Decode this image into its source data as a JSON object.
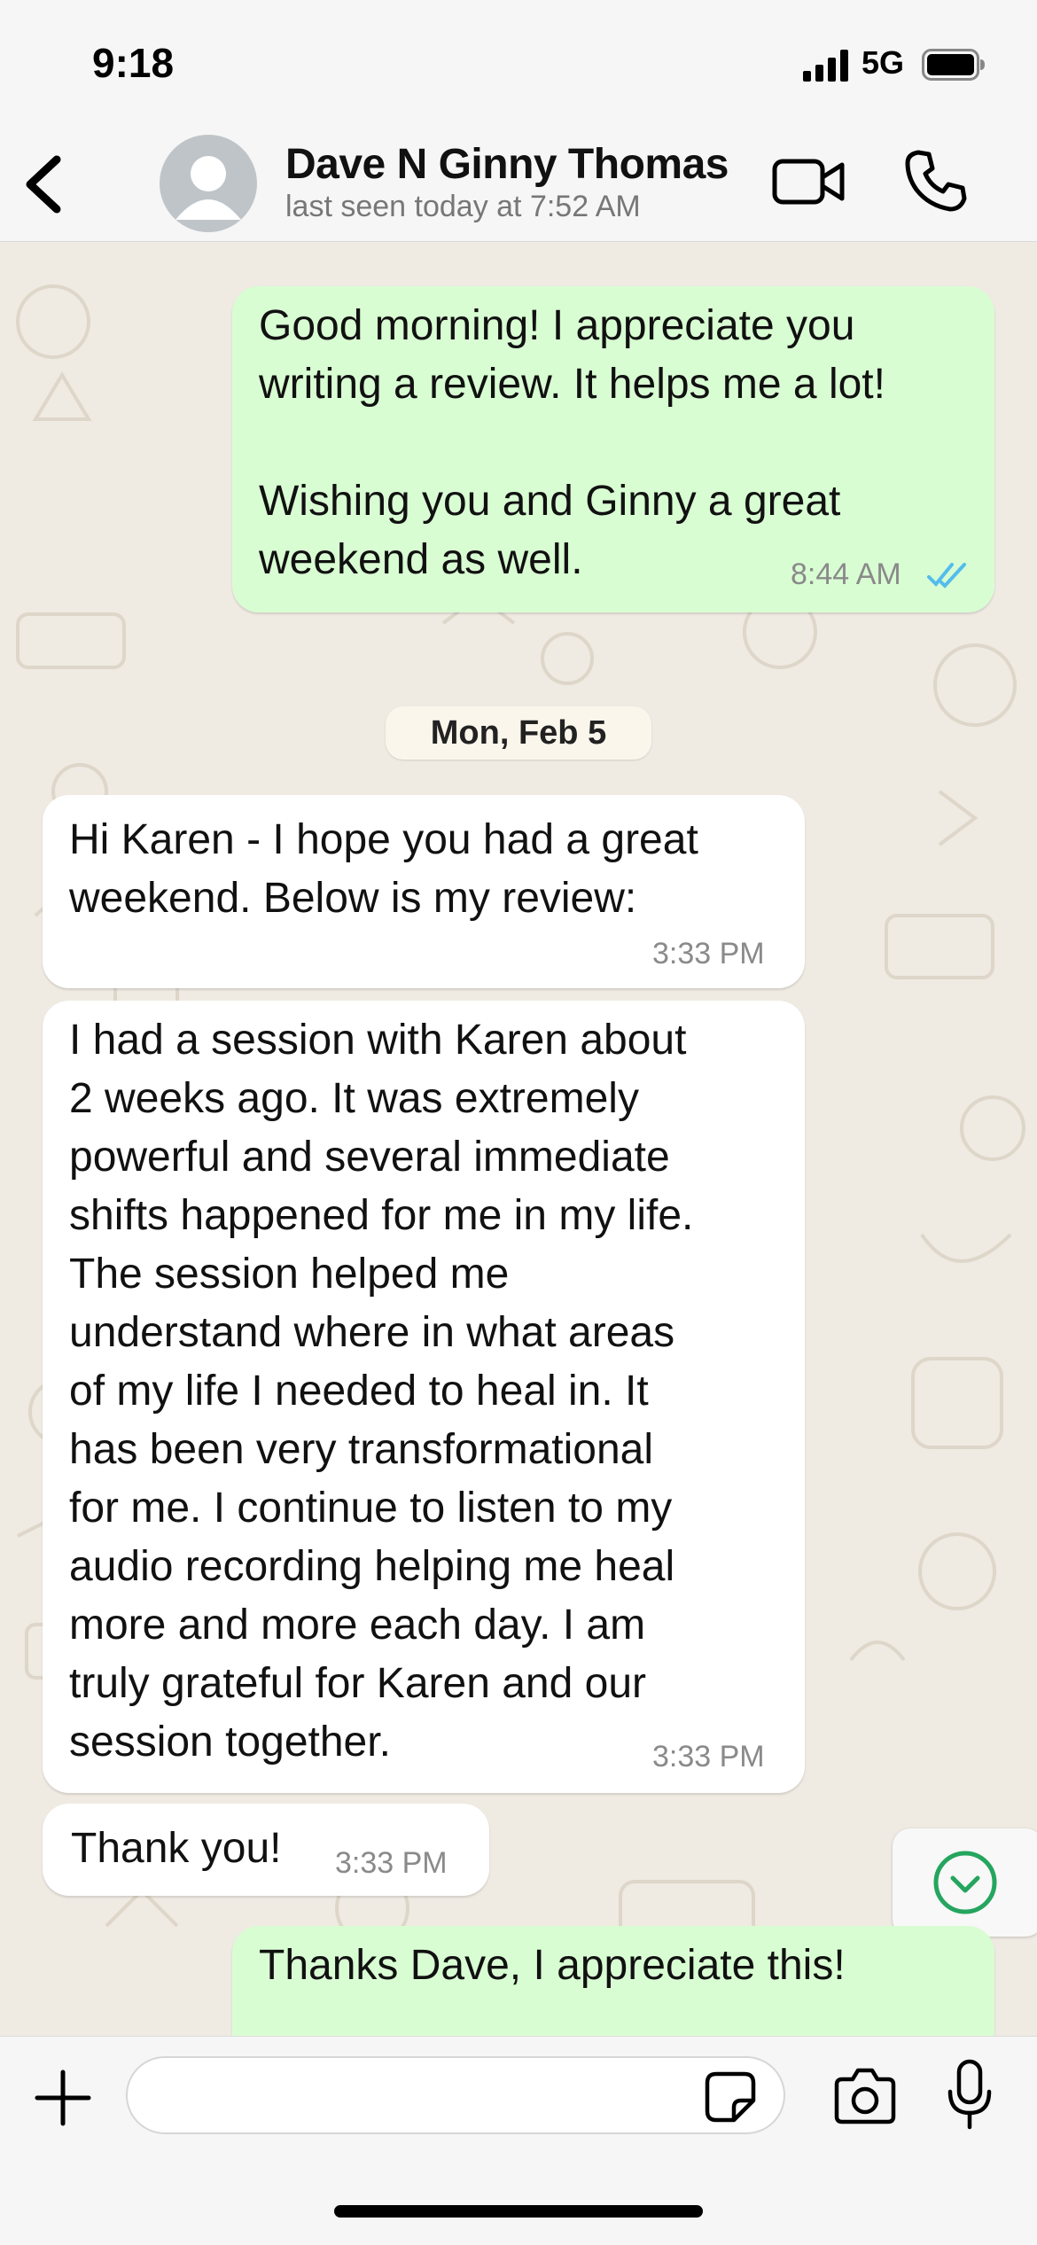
{
  "status_bar": {
    "time": "9:18",
    "network": "5G",
    "signal_icon": "signal-bars-icon",
    "battery_icon": "battery-icon"
  },
  "header": {
    "contact_name": "Dave N Ginny Thomas",
    "last_seen": "last seen today at 7:52 AM",
    "icons": [
      "back-chevron-icon",
      "avatar-placeholder-icon",
      "video-call-icon",
      "phone-call-icon"
    ]
  },
  "date_divider": "Mon, Feb 5",
  "messages": [
    {
      "direction": "outgoing",
      "text": "Good morning! I appreciate you\nwriting a review. It helps me a lot!\n\nWishing you and Ginny a great\nweekend as well.",
      "time": "8:44 AM",
      "status": "read"
    },
    {
      "direction": "incoming",
      "text": "Hi Karen - I hope you had a great\nweekend.  Below is my review:",
      "time": "3:33 PM"
    },
    {
      "direction": "incoming",
      "text": "I had a session with Karen about\n2 weeks ago.  It was extremely\npowerful and several immediate\nshifts happened for me in my life.\nThe session helped me\nunderstand where in what areas\nof my life I needed to heal in.  It\nhas been very transformational\nfor me.  I continue to listen to my\naudio recording helping me heal\nmore and more each day.  I am\ntruly grateful for Karen and our\nsession together.",
      "time": "3:33 PM"
    },
    {
      "direction": "incoming",
      "text": "Thank you!",
      "time": "3:33 PM"
    },
    {
      "direction": "outgoing",
      "text": "Thanks Dave, I appreciate this!"
    }
  ],
  "composer": {
    "value": "",
    "icons": [
      "plus-icon",
      "sticker-icon",
      "camera-icon",
      "microphone-icon"
    ]
  },
  "colors": {
    "outgoing_bubble": "#d9fdd3",
    "incoming_bubble": "#ffffff",
    "chat_background": "#efeae2",
    "read_ticks": "#53bdeb",
    "scroll_button_accent": "#25a55f"
  }
}
